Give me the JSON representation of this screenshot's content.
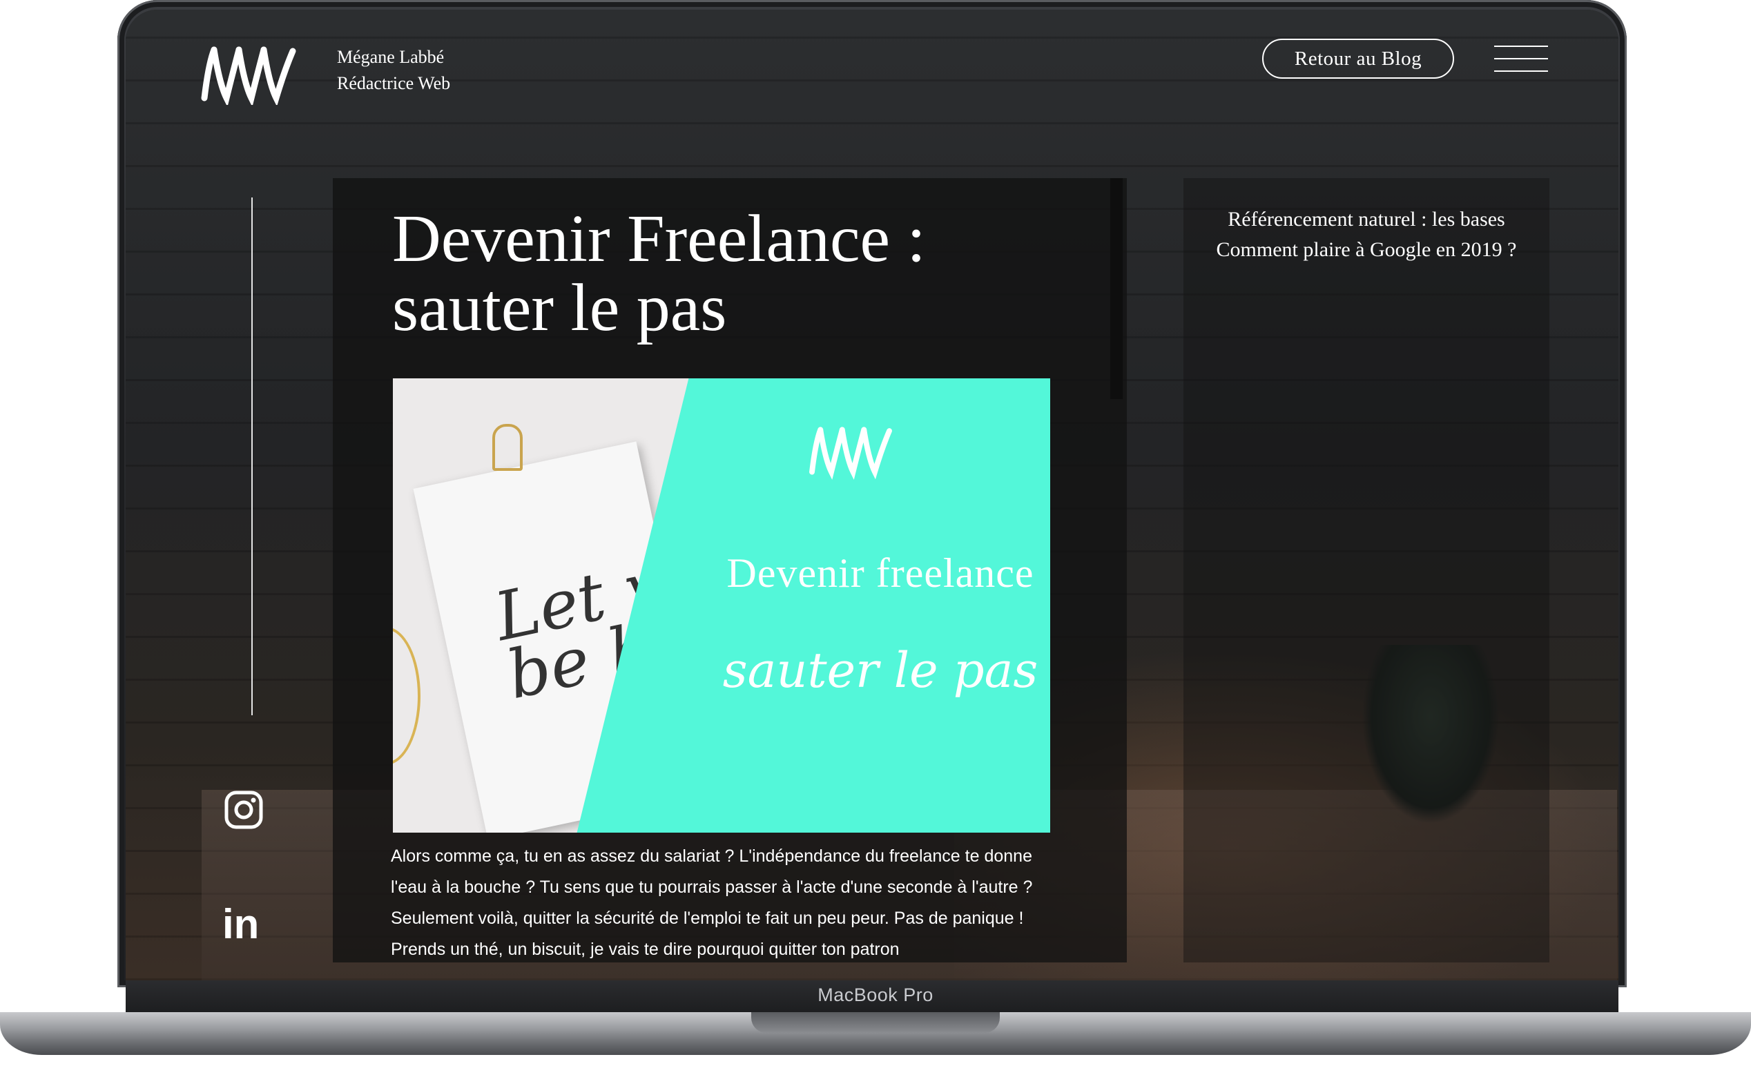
{
  "device": {
    "label": "MacBook Pro"
  },
  "header": {
    "brand_name": "Mégane Labbé",
    "brand_role": "Rédactrice Web",
    "back_button": "Retour au Blog",
    "logo_icon": "ml-monogram-logo",
    "menu_icon": "hamburger-menu-icon"
  },
  "social": {
    "instagram_icon": "instagram-icon",
    "linkedin_icon": "linkedin-icon",
    "linkedin_text": "in"
  },
  "article": {
    "title": "Devenir Freelance : sauter le pas",
    "hero": {
      "script_text": "Let your Dream be bigger than",
      "line1": "Devenir freelance",
      "line2": "sauter le pas",
      "accent_color": "#53f7d9"
    },
    "body": "Alors comme ça, tu en as assez du salariat ? L'indépendance du freelance te donne l'eau à la bouche ? Tu sens que tu pourrais passer à l'acte d'une seconde à l'autre ? Seulement voilà, quitter la sécurité de l'emploi te fait un peu peur. Pas de panique ! Prends un thé, un biscuit, je vais te dire pourquoi quitter ton patron"
  },
  "sidebar": {
    "related_title": "Référencement naturel : les bases Comment plaire à Google en 2019 ?"
  }
}
